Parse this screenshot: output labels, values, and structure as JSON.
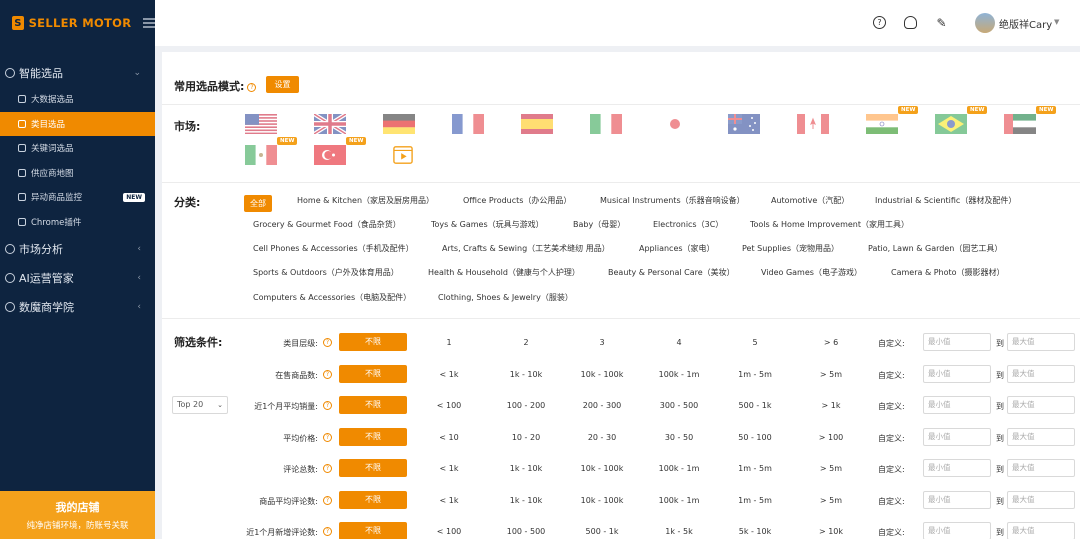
{
  "brand": {
    "name": "SELLER MOTOR",
    "logo_letter": "S"
  },
  "sidebar": {
    "sections": [
      {
        "label": "智能选品",
        "icon": "search-icon",
        "chevron": "⌄",
        "items": [
          {
            "label": "大数据选品",
            "icon": "cloud-icon"
          },
          {
            "label": "类目选品",
            "icon": "grid-icon",
            "active": true
          },
          {
            "label": "关键词选品",
            "icon": "keyword-icon"
          },
          {
            "label": "供应商地图",
            "icon": "pin-icon"
          },
          {
            "label": "异动商品监控",
            "icon": "monitor-icon",
            "badge": "NEW"
          },
          {
            "label": "Chrome插件",
            "icon": "plugin-icon"
          }
        ]
      },
      {
        "label": "市场分析",
        "icon": "compass-icon",
        "chevron": "‹"
      },
      {
        "label": "AI运营管家",
        "icon": "trend-icon",
        "chevron": "‹"
      },
      {
        "label": "数魔商学院",
        "icon": "school-icon",
        "chevron": "‹"
      }
    ],
    "shop": {
      "title": "我的店铺",
      "subtitle": "纯净店铺环境，防账号关联"
    }
  },
  "header": {
    "icons": [
      "help-icon",
      "headset-icon",
      "edit-icon"
    ],
    "user_name": "绝版祥Cary"
  },
  "main": {
    "mode_label": "常用选品模式:",
    "set_label": "设置",
    "market_label": "市场:",
    "markets": [
      {
        "name": "us-flag-icon",
        "new": false
      },
      {
        "name": "uk-flag-icon",
        "new": false
      },
      {
        "name": "de-flag-icon",
        "new": false
      },
      {
        "name": "fr-flag-icon",
        "new": false
      },
      {
        "name": "es-flag-icon",
        "new": false
      },
      {
        "name": "it-flag-icon",
        "new": false
      },
      {
        "name": "jp-flag-icon",
        "new": false
      },
      {
        "name": "au-flag-icon",
        "new": false
      },
      {
        "name": "ca-flag-icon",
        "new": false
      },
      {
        "name": "in-flag-icon",
        "new": true
      },
      {
        "name": "br-flag-icon",
        "new": true
      },
      {
        "name": "ae-flag-icon",
        "new": true
      },
      {
        "name": "mx-flag-icon",
        "new": true
      },
      {
        "name": "tr-flag-icon",
        "new": true
      },
      {
        "name": "video-icon",
        "new": false
      }
    ],
    "new_badge": "NEW",
    "category_label": "分类:",
    "categories": [
      [
        "全部",
        "Home & Kitchen（家居及厨房用品）",
        "Office Products（办公用品）",
        "Musical Instruments（乐器音响设备）",
        "Automotive（汽配）",
        "Industrial & Scientific（器材及配件）"
      ],
      [
        "Grocery & Gourmet Food（食品杂货）",
        "Toys & Games（玩具与游戏）",
        "Baby（母婴）",
        "Electronics（3C）",
        "Tools & Home Improvement（家用工具）"
      ],
      [
        "Cell Phones & Accessories（手机及配件）",
        "Arts, Crafts & Sewing（工艺美术缝纫 用品）",
        "Appliances（家电）",
        "Pet Supplies（宠物用品）",
        "Patio, Lawn & Garden（园艺工具）"
      ],
      [
        "Sports & Outdoors（户外及体育用品）",
        "Health & Household（健康与个人护理）",
        "Beauty & Personal Care（美妆）",
        "Video Games（电子游戏）",
        "Camera & Photo（摄影器材）"
      ],
      [
        "Computers & Accessories（电脑及配件）",
        "Clothing, Shoes & Jewelry（服装）"
      ]
    ],
    "filter_label": "筛选条件:",
    "top_select": "Top 20",
    "no_limit": "不限",
    "custom_label": "自定义:",
    "min_placeholder": "最小值",
    "max_placeholder": "最大值",
    "to_label": "到",
    "filters": [
      {
        "label": "类目层级:",
        "options": [
          "1",
          "2",
          "3",
          "4",
          "5",
          "> 6"
        ]
      },
      {
        "label": "在售商品数:",
        "options": [
          "< 1k",
          "1k - 10k",
          "10k - 100k",
          "100k - 1m",
          "1m - 5m",
          "> 5m"
        ]
      },
      {
        "label": "近1个月平均销量:",
        "options": [
          "< 100",
          "100 - 200",
          "200 - 300",
          "300 - 500",
          "500 - 1k",
          "> 1k"
        ]
      },
      {
        "label": "平均价格:",
        "options": [
          "< 10",
          "10 - 20",
          "20 - 30",
          "30 - 50",
          "50 - 100",
          "> 100"
        ]
      },
      {
        "label": "评论总数:",
        "options": [
          "< 1k",
          "1k - 10k",
          "10k - 100k",
          "100k - 1m",
          "1m - 5m",
          "> 5m"
        ]
      },
      {
        "label": "商品平均评论数:",
        "options": [
          "< 1k",
          "1k - 10k",
          "10k - 100k",
          "100k - 1m",
          "1m - 5m",
          "> 5m"
        ]
      },
      {
        "label": "近1个月新增评论数:",
        "options": [
          "< 100",
          "100 - 500",
          "500 - 1k",
          "1k - 5k",
          "5k - 10k",
          "> 10k"
        ]
      }
    ]
  }
}
